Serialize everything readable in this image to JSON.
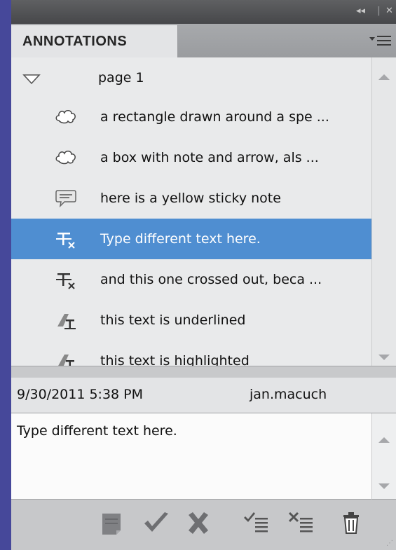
{
  "window": {
    "collapse_glyph": "◂◂",
    "close_glyph": "✕"
  },
  "panel": {
    "tab_label": "ANNOTATIONS",
    "menu_icon": "panel-menu-icon"
  },
  "list": {
    "page_label": "page 1",
    "items": [
      {
        "icon": "cloud-icon",
        "text": "a rectangle drawn around a spe ..."
      },
      {
        "icon": "cloud-icon",
        "text": "a box with note and arrow, als ..."
      },
      {
        "icon": "sticky-note-icon",
        "text": "here is a yellow sticky note"
      },
      {
        "icon": "replace-text-icon",
        "text": "Type different text here.",
        "selected": true
      },
      {
        "icon": "strikethrough-icon",
        "text": "and this one crossed out, beca ..."
      },
      {
        "icon": "underline-icon",
        "text": "this text is underlined"
      },
      {
        "icon": "highlight-icon",
        "text": "this text is highlighted"
      }
    ]
  },
  "detail": {
    "date": "9/30/2011 5:38 PM",
    "author": "jan.macuch",
    "comment": "Type different text here."
  },
  "toolbar": {
    "buttons": [
      "note-icon",
      "accept-checkmark-icon",
      "reject-x-icon",
      "accept-all-icon",
      "reject-all-icon",
      "trash-icon"
    ]
  },
  "colors": {
    "background": "#46489a",
    "selection": "#4f8ed1",
    "panel": "#cfd1d3"
  }
}
